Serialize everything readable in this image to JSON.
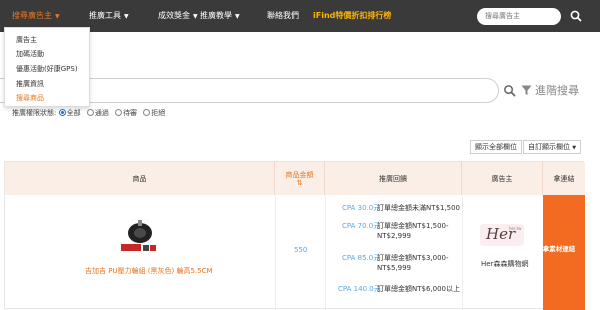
{
  "nav": {
    "items": [
      {
        "label": "搜尋廣告主"
      },
      {
        "label": "推廣工具"
      },
      {
        "label": "成效獎金"
      },
      {
        "label": "推廣教學"
      },
      {
        "label": "聯絡我們"
      },
      {
        "label": "iFind特價折扣排行榜"
      }
    ],
    "search_placeholder": "搜尋廣告主",
    "search_icon": "search-icon"
  },
  "dropdown": {
    "items": [
      {
        "label": "廣告主"
      },
      {
        "label": "加碼活動"
      },
      {
        "label": "優惠活動(好康GPS)"
      },
      {
        "label": "推廣資訊"
      },
      {
        "label": "搜尋商品"
      }
    ]
  },
  "search": {
    "filter_label": "進階搜尋"
  },
  "status_filter": {
    "label": "推廣權限狀態:",
    "options": [
      "全部",
      "通過",
      "待審",
      "拒絕"
    ],
    "selected": "全部"
  },
  "column_buttons": {
    "show_all": "顯示全部欄位",
    "custom": "自訂顯示欄位"
  },
  "table": {
    "headers": {
      "product": "商品",
      "price_line1": "商品金額",
      "bonus": "推廣回饋",
      "advertiser": "廣告主",
      "link": "拿連結"
    },
    "rows": [
      {
        "product_name": "吉加吉 PU壓力輪組 (黑灰色) 輪高5.5CM",
        "price": "550",
        "bonus": [
          {
            "cpa": "CPA 30.0元",
            "cond": "訂單總金額未滿NT$1,500"
          },
          {
            "cpa": "CPA 70.0元",
            "cond1": "訂單總金額NT$1,500-",
            "cond2": "NT$2,999"
          },
          {
            "cpa": "CPA 85.0元",
            "cond1": "訂單總金額NT$3,000-",
            "cond2": "NT$5,999"
          },
          {
            "cpa": "CPA 140.0元",
            "cond": "訂單總金額NT$6,000以上"
          }
        ],
        "advertiser_logo": "Her",
        "advertiser_logo_small": "her.tw",
        "advertiser_name": "Her森森購物網",
        "link_button": "拿素材連結"
      }
    ]
  },
  "colors": {
    "nav_bg": "#3a3a3a",
    "accent": "#e9751f",
    "hot": "#ffb400",
    "header_bg": "#fbeee6",
    "price_blue": "#5aa8dd",
    "link_btn_bg": "#f26b21"
  }
}
